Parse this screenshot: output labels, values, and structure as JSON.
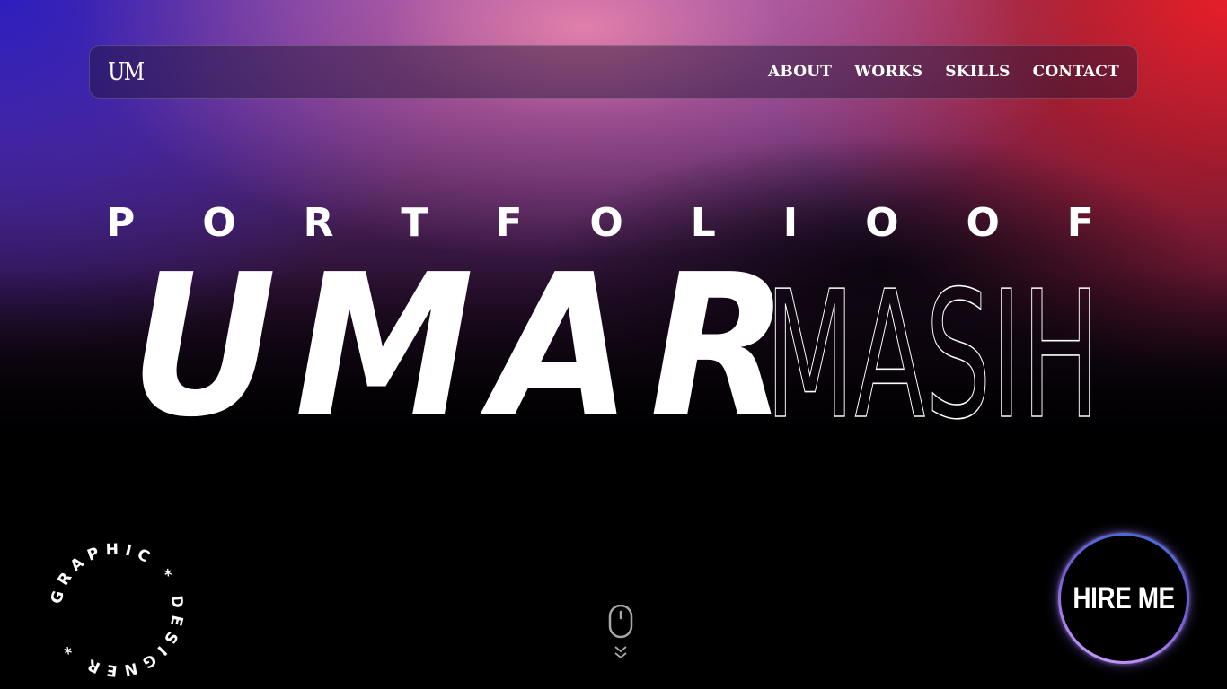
{
  "nav": {
    "logo": "UM",
    "links": [
      "ABOUT",
      "WORKS",
      "SKILLS",
      "CONTACT"
    ]
  },
  "hero": {
    "kicker_letters": [
      "P",
      "O",
      "R",
      "T",
      "F",
      "O",
      "L",
      "I",
      "O",
      "O",
      "F"
    ],
    "first_name": "UMAR",
    "last_name": "MASIH"
  },
  "badge": {
    "text": "GRAPHIC * DESIGNER * "
  },
  "hire_button": {
    "label": "HIRE ME"
  },
  "icons": {
    "scroll": "mouse-scroll-icon",
    "chevrons": "double-chevron-down-icon"
  },
  "colors": {
    "gradient_blue": "#2d1ebe",
    "gradient_pink": "#e682aa",
    "gradient_red": "#e61e28",
    "background": "#000000",
    "button_ring_start": "#3b6fd8",
    "button_ring_end": "#d7a6ff"
  }
}
